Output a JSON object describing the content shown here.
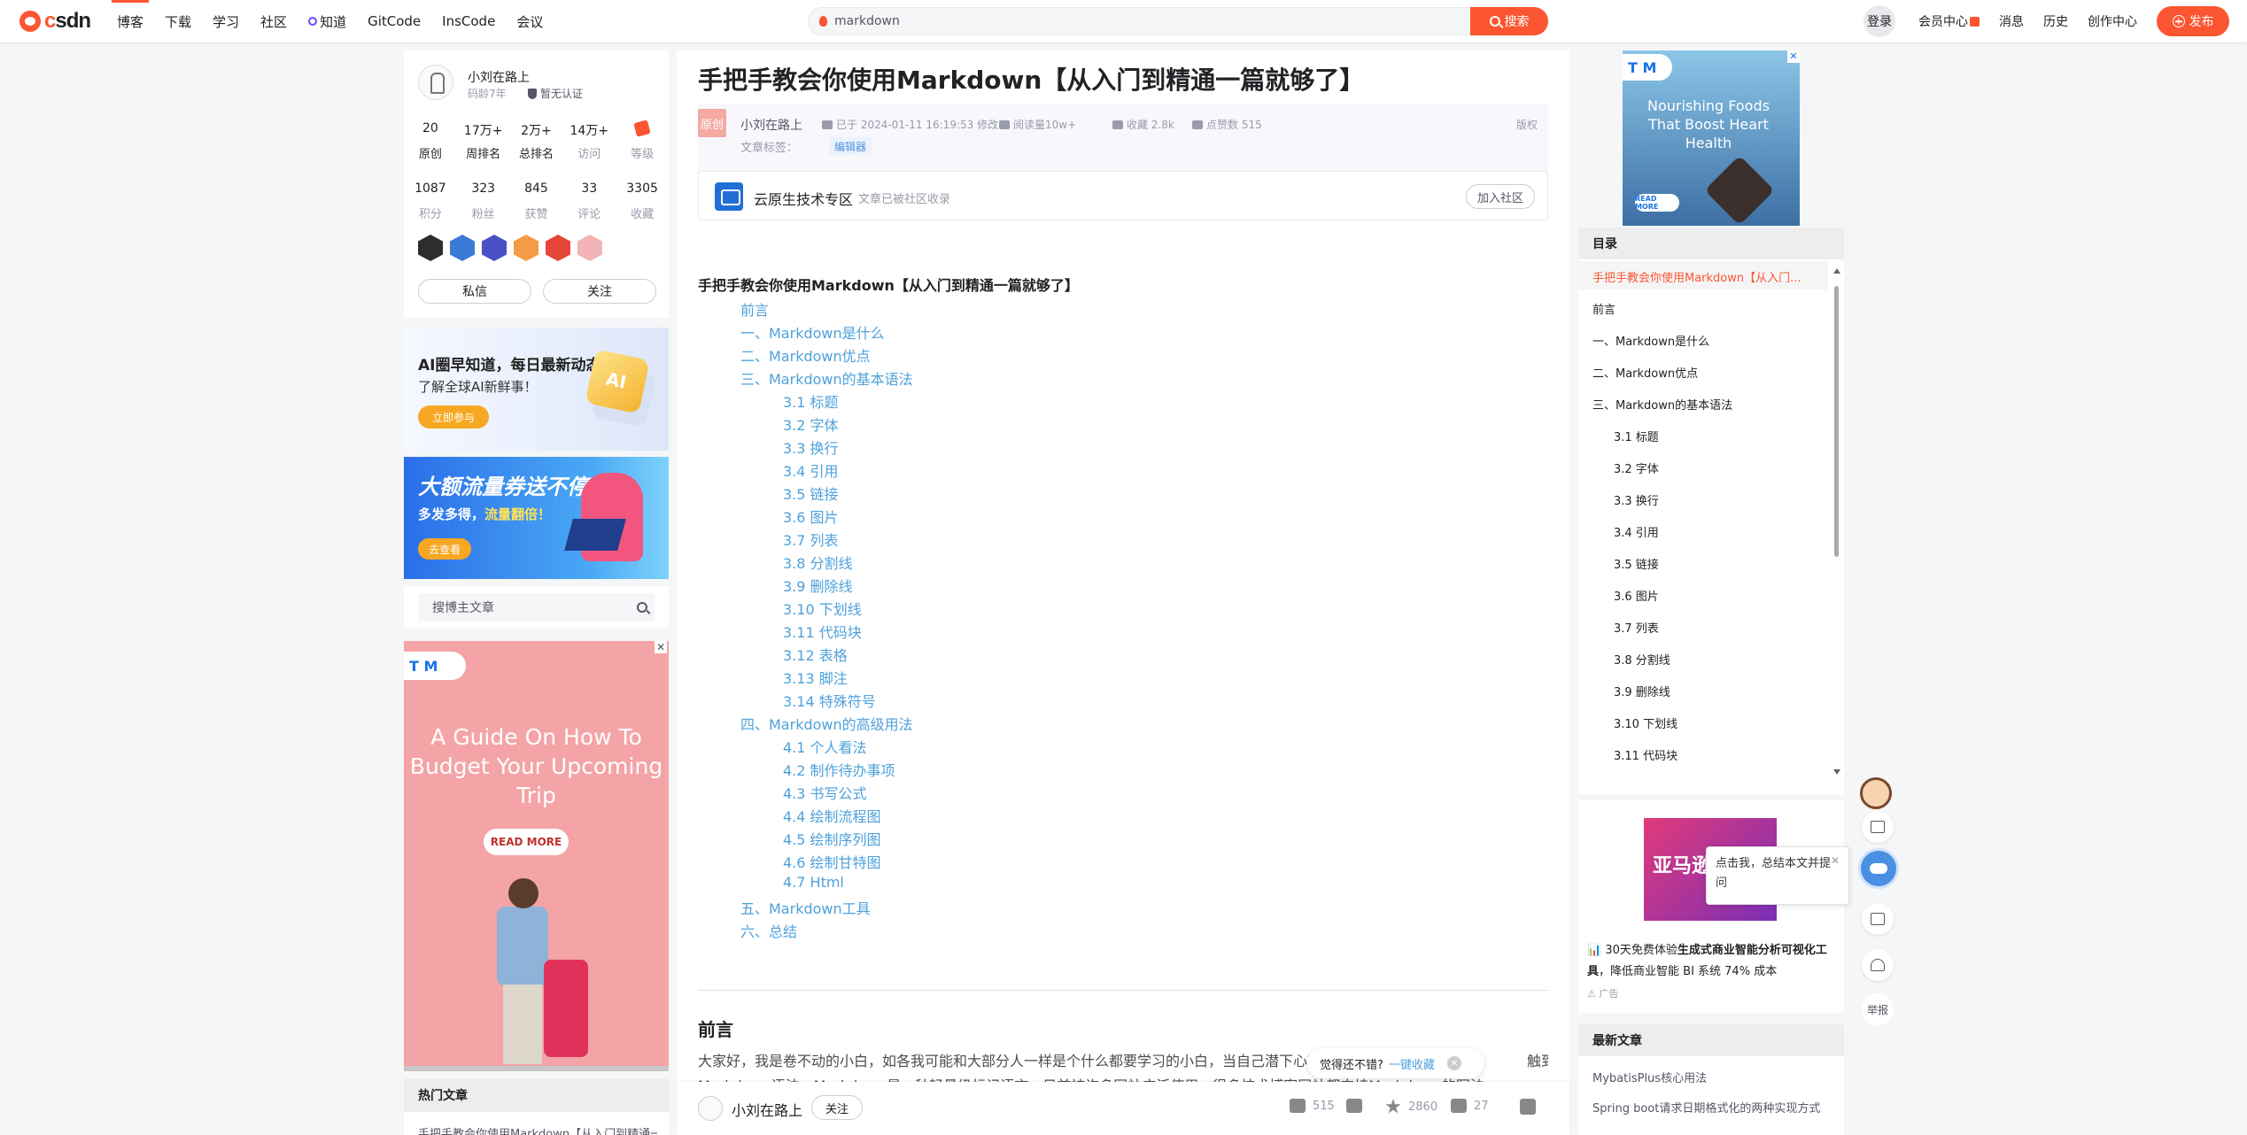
{
  "topbar": {
    "logo_text": "csdn",
    "nav": [
      "博客",
      "下载",
      "学习",
      "社区",
      "知道",
      "GitCode",
      "InsCode",
      "会议"
    ],
    "search_value": "markdown",
    "search_button": "搜索",
    "login": "登录",
    "member_center": "会员中心",
    "messages": "消息",
    "history": "历史",
    "creator_center": "创作中心",
    "publish": "发布"
  },
  "profile": {
    "username": "小刘在路上",
    "code_age": "码龄7年",
    "auth": "暂无认证",
    "stats1": [
      {
        "value": "20",
        "label": "原创"
      },
      {
        "value": "17万+",
        "label": "周排名"
      },
      {
        "value": "2万+",
        "label": "总排名"
      },
      {
        "value": "14万+",
        "label": "访问"
      },
      {
        "value": "",
        "label": "等级"
      }
    ],
    "stats2": [
      {
        "value": "1087",
        "label": "积分"
      },
      {
        "value": "323",
        "label": "粉丝"
      },
      {
        "value": "845",
        "label": "获赞"
      },
      {
        "value": "33",
        "label": "评论"
      },
      {
        "value": "3305",
        "label": "收藏"
      }
    ],
    "private_msg": "私信",
    "follow": "关注"
  },
  "ad_left_1": {
    "title": "AI圈早知道，每日最新动态",
    "subtitle": "了解全球AI新鲜事！",
    "button": "立即参与",
    "icon_text": "AI"
  },
  "ad_left_2": {
    "title": "大额流量券送不停",
    "subtitle_a": "多发多得，",
    "subtitle_b": "流量翻倍！",
    "button": "去查看"
  },
  "blog_search": {
    "placeholder": "搜博主文章"
  },
  "ad_left_3": {
    "logo": "T M",
    "close": "✕",
    "headline": "A Guide On How To Budget Your Upcoming Trip",
    "button": "READ MORE"
  },
  "hot_articles": {
    "title": "热门文章",
    "items": [
      "手把手教会你使用Markdown【从入门到精通一篇就够了】"
    ]
  },
  "article": {
    "title": "手把手教会你使用Markdown【从入门到精通一篇就够了】",
    "original_badge": "原创",
    "author": "小刘在路上",
    "date": "已于 2024-01-11 16:19:53 修改",
    "views": "阅读量10w+",
    "favorites": "收藏 2.8k",
    "likes": "点赞数 515",
    "copyright": "版权",
    "tags_label": "文章标签：",
    "tag": "编辑器",
    "community_name": "云原生技术专区",
    "community_desc": "文章已被社区收录",
    "join_community": "加入社区",
    "body_heading": "手把手教会你使用Markdown【从入门到精通一篇就够了】",
    "toc": [
      {
        "text": "前言",
        "level": 1
      },
      {
        "text": "一、Markdown是什么",
        "level": 1
      },
      {
        "text": "二、Markdown优点",
        "level": 1
      },
      {
        "text": "三、Markdown的基本语法",
        "level": 1
      },
      {
        "text": "3.1 标题",
        "level": 2
      },
      {
        "text": "3.2 字体",
        "level": 2
      },
      {
        "text": "3.3 换行",
        "level": 2
      },
      {
        "text": "3.4 引用",
        "level": 2
      },
      {
        "text": "3.5 链接",
        "level": 2
      },
      {
        "text": "3.6 图片",
        "level": 2
      },
      {
        "text": "3.7 列表",
        "level": 2
      },
      {
        "text": "3.8 分割线",
        "level": 2
      },
      {
        "text": "3.9 删除线",
        "level": 2
      },
      {
        "text": "3.10 下划线",
        "level": 2
      },
      {
        "text": "3.11 代码块",
        "level": 2
      },
      {
        "text": "3.12 表格",
        "level": 2
      },
      {
        "text": "3.13 脚注",
        "level": 2
      },
      {
        "text": "3.14 特殊符号",
        "level": 2
      },
      {
        "text": "四、Markdown的高级用法",
        "level": 1
      },
      {
        "text": "4.1 个人看法",
        "level": 2
      },
      {
        "text": "4.2 制作待办事项",
        "level": 2
      },
      {
        "text": "4.3 书写公式",
        "level": 2
      },
      {
        "text": "4.4 绘制流程图",
        "level": 2
      },
      {
        "text": "4.5 绘制序列图",
        "level": 2
      },
      {
        "text": "4.6 绘制甘特图",
        "level": 2
      },
      {
        "text": "4.7 Html",
        "level": 2
      },
      {
        "text": "五、Markdown工具",
        "level": 1
      },
      {
        "text": "六、总结",
        "level": 1
      }
    ],
    "section_title": "前言",
    "paragraph_line1": "大家好，我是卷不动的小白，如各我可能和大部分人一样是个什么都要学习的小白，当自己潜下心来学习",
    "paragraph_line1_end": "触到了",
    "paragraph_line2": "Markdown语法，Markdown是一种轻量级标记语言，目前被许多网站广泛使用，很多技术博客网站都支持Markdown的写法"
  },
  "collect_prompt": {
    "text": "觉得还不错?",
    "link": "一键收藏",
    "close": "✕"
  },
  "toolbar": {
    "author": "小刘在路上",
    "follow": "关注",
    "likes": "515",
    "favorites": "2860",
    "comments": "27"
  },
  "ad_right_1": {
    "logo": "T M",
    "close": "✕",
    "headline": "Nourishing Foods That Boost Heart Health",
    "button": "READ MORE"
  },
  "toc_sidebar": {
    "title": "目录",
    "items": [
      {
        "text": "手把手教会你使用Markdown【从入门...",
        "level": 1,
        "active": true
      },
      {
        "text": "前言",
        "level": 1
      },
      {
        "text": "一、Markdown是什么",
        "level": 1
      },
      {
        "text": "二、Markdown优点",
        "level": 1
      },
      {
        "text": "三、Markdown的基本语法",
        "level": 1
      },
      {
        "text": "3.1 标题",
        "level": 2
      },
      {
        "text": "3.2 字体",
        "level": 2
      },
      {
        "text": "3.3 换行",
        "level": 2
      },
      {
        "text": "3.4 引用",
        "level": 2
      },
      {
        "text": "3.5 链接",
        "level": 2
      },
      {
        "text": "3.6 图片",
        "level": 2
      },
      {
        "text": "3.7 列表",
        "level": 2
      },
      {
        "text": "3.8 分割线",
        "level": 2
      },
      {
        "text": "3.9 删除线",
        "level": 2
      },
      {
        "text": "3.10 下划线",
        "level": 2
      },
      {
        "text": "3.11 代码块",
        "level": 2
      }
    ]
  },
  "ad_right_2": {
    "image_text": "亚马逊",
    "desc_a": "30天免费体验",
    "desc_b": "生成式商业智能分析可视化工具",
    "desc_c": "，降低商业智能 BI 系统 74% 成本",
    "ad_label": "广告"
  },
  "tip_popup": {
    "text": "点击我，总结本文并提问",
    "close": "✕"
  },
  "newest": {
    "title": "最新文章",
    "items": [
      "MybatisPlus核心用法",
      "Spring boot请求日期格式化的两种实现方式"
    ]
  },
  "float_bar": {
    "report": "举报"
  }
}
